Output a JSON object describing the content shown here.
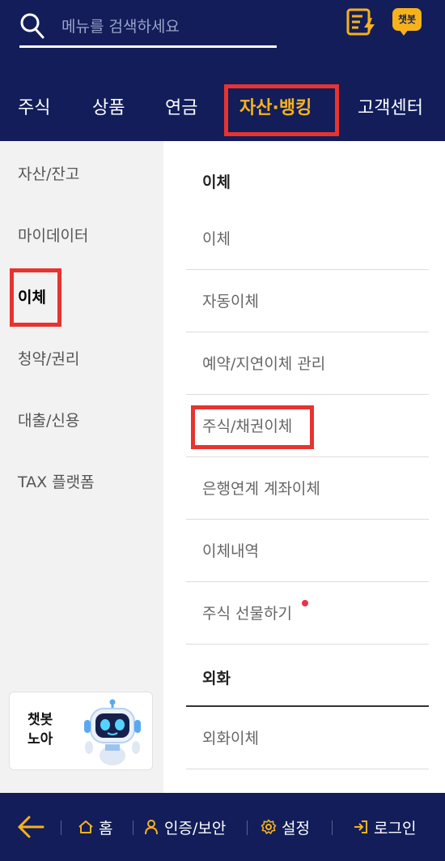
{
  "search": {
    "placeholder": "메뉴를 검색하세요"
  },
  "header_icons": {
    "note_icon": "memo-lightning-icon",
    "chatbot_badge": "챗봇"
  },
  "tabs": [
    {
      "label": "주식",
      "active": false
    },
    {
      "label": "상품",
      "active": false
    },
    {
      "label": "연금",
      "active": false
    },
    {
      "label": "자산·뱅킹",
      "active": true
    },
    {
      "label": "고객센터",
      "active": false
    }
  ],
  "sidebar": {
    "items": [
      {
        "label": "자산/잔고",
        "active": false
      },
      {
        "label": "마이데이터",
        "active": false
      },
      {
        "label": "이체",
        "active": true
      },
      {
        "label": "청약/권리",
        "active": false
      },
      {
        "label": "대출/신용",
        "active": false
      },
      {
        "label": "TAX 플랫폼",
        "active": false
      }
    ],
    "chatbot_card": {
      "line1": "챗봇",
      "line2": "노아",
      "icon": "robot-icon"
    }
  },
  "content": {
    "sections": [
      {
        "title": "이체",
        "items": [
          {
            "label": "이체"
          },
          {
            "label": "자동이체"
          },
          {
            "label": "예약/지연이체 관리"
          },
          {
            "label": "주식/채권이체",
            "highlighted": true
          },
          {
            "label": "은행연계 계좌이체"
          },
          {
            "label": "이체내역"
          },
          {
            "label": "주식 선물하기",
            "new_dot": true
          }
        ]
      },
      {
        "title": "외화",
        "items": [
          {
            "label": "외화이체"
          }
        ]
      }
    ]
  },
  "bottom_bar": {
    "back_icon": "back-arrow-icon",
    "items": [
      {
        "label": "홈",
        "icon": "home-icon"
      },
      {
        "label": "인증/보안",
        "icon": "person-icon"
      },
      {
        "label": "설정",
        "icon": "gear-icon"
      },
      {
        "label": "로그인",
        "icon": "login-icon"
      }
    ]
  },
  "colors": {
    "navy": "#121d5a",
    "accent_yellow": "#f6b21b",
    "highlight_red": "#e8332f",
    "sidebar_bg": "#f2f2f2"
  }
}
